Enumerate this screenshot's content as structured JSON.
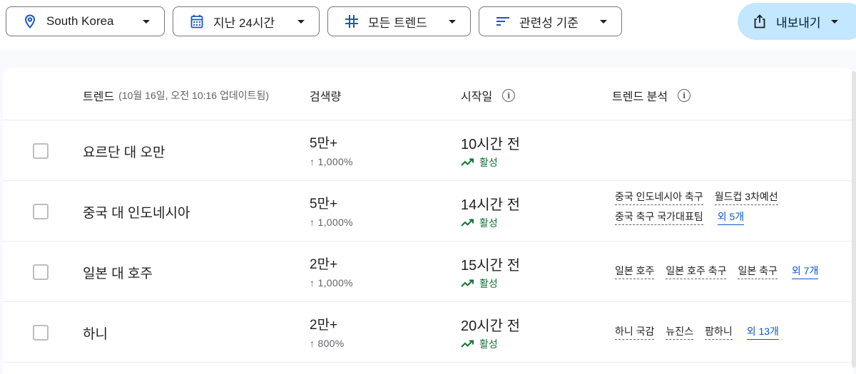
{
  "filters": {
    "location": {
      "label": "South Korea",
      "icon": "location-pin-icon"
    },
    "time": {
      "label": "지난 24시간",
      "icon": "calendar-icon"
    },
    "category": {
      "label": "모든 트렌드",
      "icon": "hashtag-icon"
    },
    "sort": {
      "label": "관련성 기준",
      "icon": "sort-icon"
    }
  },
  "export": {
    "label": "내보내기",
    "icon": "share-export-icon"
  },
  "colors": {
    "accent": "#0b57d0",
    "export_bg": "#c2e7ff",
    "active_green": "#137333",
    "icon_blue": "#1a56c9"
  },
  "table": {
    "headers": {
      "trend": "트렌드",
      "trend_sub": "(10월 16일, 오전 10:16 업데이트됨)",
      "volume": "검색량",
      "started": "시작일",
      "breakdown": "트렌드 분석"
    },
    "rows": [
      {
        "name": "요르단 대 오만",
        "volume": "5만+",
        "pct": "↑ 1,000%",
        "started": "10시간 전",
        "status": "활성",
        "queries": [],
        "more": ""
      },
      {
        "name": "중국 대 인도네시아",
        "volume": "5만+",
        "pct": "↑ 1,000%",
        "started": "14시간 전",
        "status": "활성",
        "queries": [
          "중국 인도네시아 축구",
          "월드컵 3차예선",
          "중국 축구 국가대표팀"
        ],
        "more": "외 5개"
      },
      {
        "name": "일본 대 호주",
        "volume": "2만+",
        "pct": "↑ 1,000%",
        "started": "15시간 전",
        "status": "활성",
        "queries": [
          "일본 호주",
          "일본 호주 축구",
          "일본 축구"
        ],
        "more": "외 7개"
      },
      {
        "name": "하니",
        "volume": "2만+",
        "pct": "↑ 800%",
        "started": "20시간 전",
        "status": "활성",
        "queries": [
          "하니 국감",
          "뉴진스",
          "팜하니"
        ],
        "more": "외 13개"
      }
    ]
  }
}
